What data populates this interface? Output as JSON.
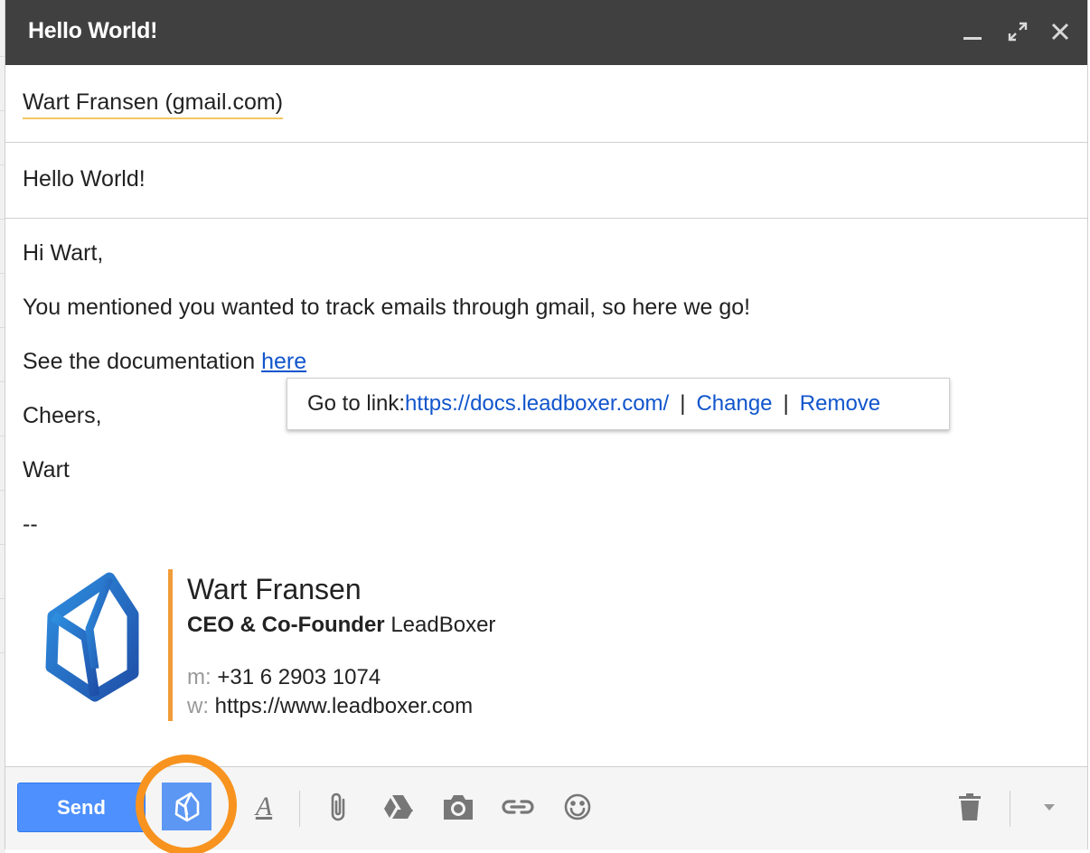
{
  "window": {
    "title": "Hello World!"
  },
  "to": {
    "recipient": "Wart Fransen (gmail.com)"
  },
  "subject": {
    "value": "Hello World!"
  },
  "body": {
    "greeting": "Hi Wart,",
    "line1": "You mentioned you wanted to track emails through gmail, so here we go!",
    "line2_prefix": "See the documentation ",
    "line2_link": "here",
    "closing": "Cheers,",
    "sender": "Wart",
    "sig_separator": "--"
  },
  "link_popup": {
    "prefix": "Go to link: ",
    "url": "https://docs.leadboxer.com/",
    "sep": "|",
    "change": "Change",
    "remove": "Remove"
  },
  "signature": {
    "name": "Wart Fransen",
    "role": "CEO & Co-Founder",
    "company": " LeadBoxer",
    "mobile_label": "m:",
    "mobile": " +31 6 2903 1074",
    "web_label": "w:",
    "web": " https://www.leadboxer.com"
  },
  "toolbar": {
    "send_label": "Send",
    "format_icon_glyph": "A"
  },
  "colors": {
    "titlebar": "#404040",
    "send": "#4d90fe",
    "link": "#1155cc",
    "accent": "#f19c38",
    "highlight": "#f7931e"
  }
}
